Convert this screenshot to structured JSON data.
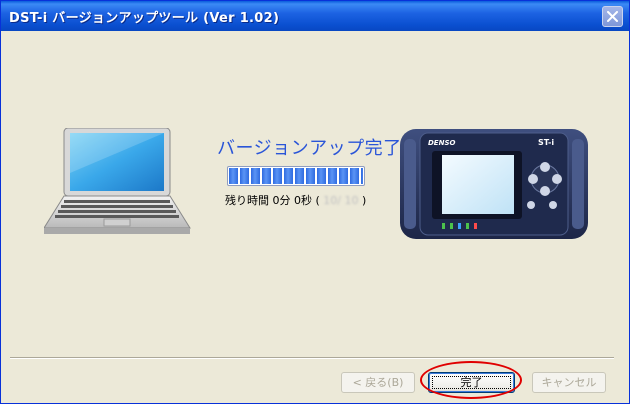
{
  "window": {
    "title": "DST-i バージョンアップツール (Ver 1.02)"
  },
  "status": {
    "heading": "バージョンアップ完了",
    "progress": 1.0,
    "time_label": "残り時間",
    "minutes": "0分",
    "seconds": "0秒",
    "paren_open": "(",
    "blurred_value": "10/ 10",
    "paren_close": ")"
  },
  "device": {
    "brand": "DENSO",
    "model": "ST-i"
  },
  "buttons": {
    "back": "< 戻る(B)",
    "finish": "完了",
    "cancel": "キャンセル"
  },
  "colors": {
    "title_bar": "#0a5ddc",
    "accent_text": "#2a55d8",
    "progress": "#2f6be0",
    "highlight": "#e00000",
    "device_body": "#27345a"
  }
}
